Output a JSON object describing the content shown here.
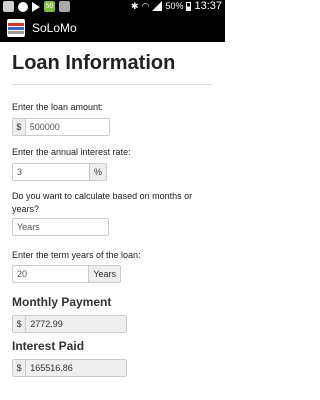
{
  "status_bar": {
    "battery": "50%",
    "time": "13:37",
    "notification_count": "50"
  },
  "action_bar": {
    "title": "SoLoMo"
  },
  "page": {
    "title": "Loan Information"
  },
  "form": {
    "loan_amount": {
      "label": "Enter the loan amount:",
      "prefix": "$",
      "value": "500000"
    },
    "interest_rate": {
      "label": "Enter the annual interest rate:",
      "value": "3",
      "suffix": "%"
    },
    "calc_basis": {
      "label": "Do you want to calculate based on months or years?",
      "value": "Years"
    },
    "term": {
      "label": "Enter the term years of the loan:",
      "value": "20",
      "suffix": "Years"
    }
  },
  "results": {
    "monthly_payment": {
      "label": "Monthly Payment",
      "prefix": "$",
      "value": "2772.99"
    },
    "interest_paid": {
      "label": "Interest Paid",
      "prefix": "$",
      "value": "165516.86"
    }
  },
  "colors": {
    "status_bar_bg": "#000000",
    "addon_bg": "#eeeeee",
    "border": "#cccccc"
  }
}
